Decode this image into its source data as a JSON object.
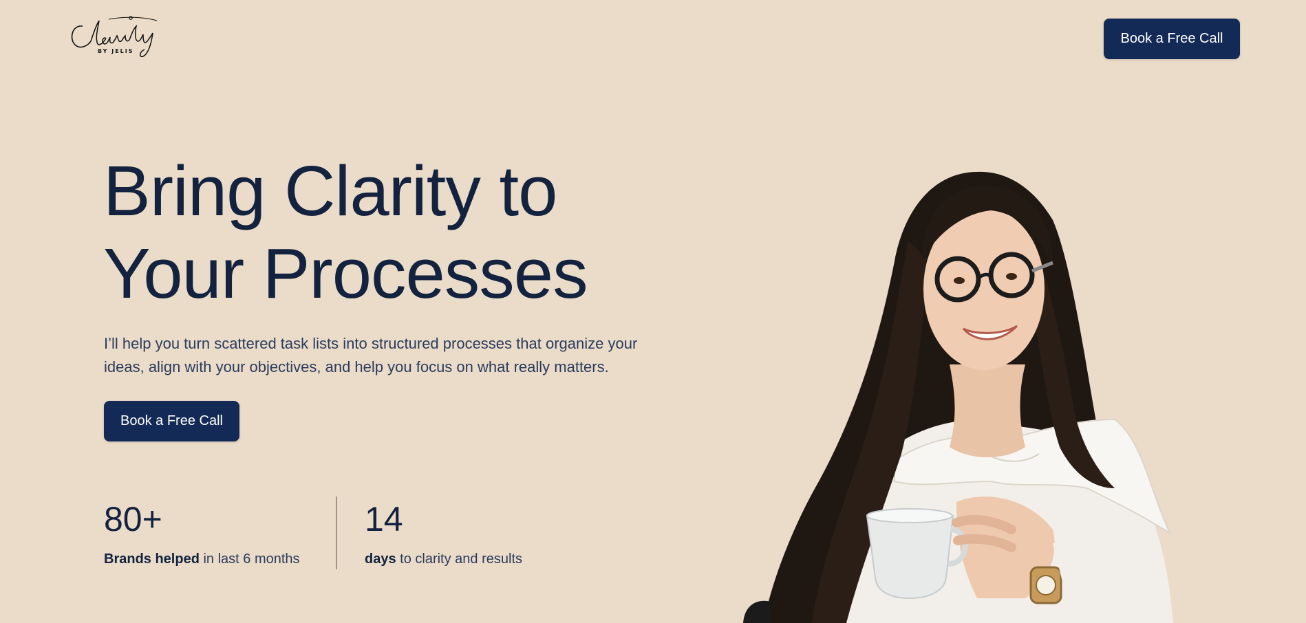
{
  "header": {
    "logo_text": "Clarity",
    "logo_sub": "BY JELIS",
    "cta_label": "Book a Free Call"
  },
  "hero": {
    "title_line1": "Bring Clarity to",
    "title_line2": "Your Processes",
    "subtitle_line1": "I’ll help you turn scattered task lists into structured processes that organize your",
    "subtitle_line2": "ideas, align with your objectives, and help you focus on what really matters.",
    "cta_label": "Book a Free Call"
  },
  "stats": [
    {
      "number": "80+",
      "label_bold": "Brands helped",
      "label_rest": " in last 6 months"
    },
    {
      "number": "14",
      "label_bold": "days",
      "label_rest": " to clarity and results"
    }
  ],
  "colors": {
    "background": "#eadcc8",
    "primary": "#132a57",
    "text": "#13223f"
  },
  "icons": {
    "portrait": "woman-with-glasses-holding-cup-photo"
  }
}
